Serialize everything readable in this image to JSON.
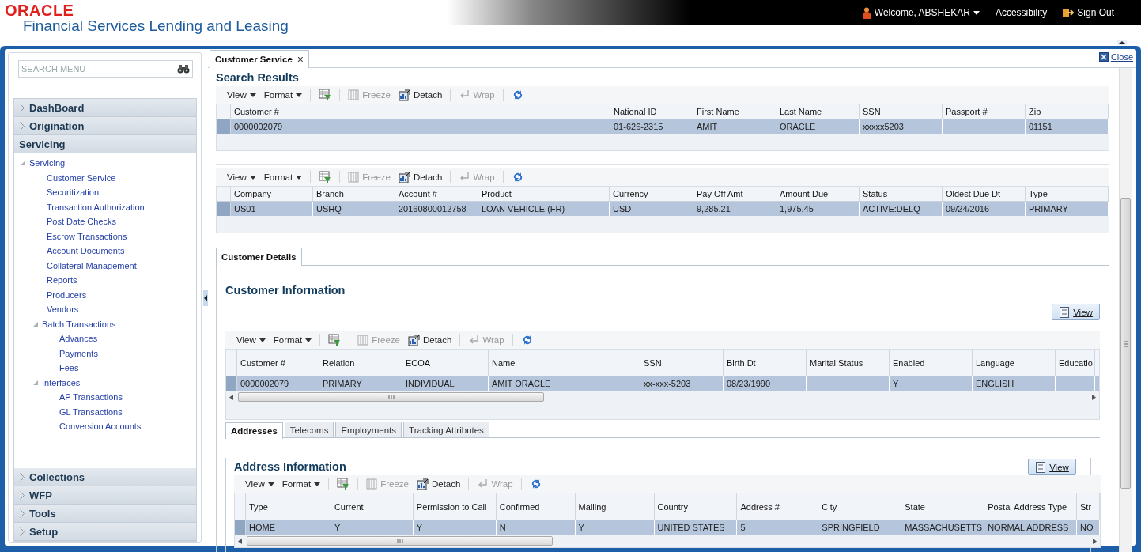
{
  "header": {
    "logo": "ORACLE",
    "app_title": "Financial Services Lending and Leasing",
    "welcome": "Welcome, ABSHEKAR",
    "accessibility": "Accessibility",
    "sign_out": "Sign Out"
  },
  "sidebar": {
    "search": {
      "placeholder": "SEARCH MENU"
    },
    "sections": [
      {
        "label": "DashBoard",
        "expanded": false
      },
      {
        "label": "Origination",
        "expanded": false
      },
      {
        "label": "Servicing",
        "expanded": true,
        "tree": [
          {
            "label": "Servicing",
            "expanded": true,
            "children": [
              {
                "label": "Customer Service"
              },
              {
                "label": "Securitization"
              },
              {
                "label": "Transaction Authorization"
              },
              {
                "label": "Post Date Checks"
              },
              {
                "label": "Escrow Transactions"
              },
              {
                "label": "Account Documents"
              },
              {
                "label": "Collateral Management"
              },
              {
                "label": "Reports"
              },
              {
                "label": "Producers"
              },
              {
                "label": "Vendors"
              },
              {
                "label": "Batch Transactions",
                "expanded": true,
                "children": [
                  {
                    "label": "Advances"
                  },
                  {
                    "label": "Payments"
                  },
                  {
                    "label": "Fees"
                  }
                ]
              },
              {
                "label": "Interfaces",
                "expanded": true,
                "children": [
                  {
                    "label": "AP Transactions"
                  },
                  {
                    "label": "GL Transactions"
                  },
                  {
                    "label": "Conversion Accounts"
                  }
                ]
              }
            ]
          }
        ]
      },
      {
        "label": "Collections",
        "expanded": false
      },
      {
        "label": "WFP",
        "expanded": false
      },
      {
        "label": "Tools",
        "expanded": false
      },
      {
        "label": "Setup",
        "expanded": false
      }
    ]
  },
  "tab": {
    "label": "Customer Service",
    "close": "×"
  },
  "close_link": "Close",
  "search_results": {
    "title": "Search Results",
    "toolbar": [
      {
        "kind": "menu",
        "label": "View",
        "disabled": false
      },
      {
        "kind": "menu",
        "label": "Format",
        "disabled": false
      },
      {
        "kind": "filter",
        "disabled": false
      },
      {
        "kind": "freeze",
        "label": "Freeze",
        "disabled": true
      },
      {
        "kind": "detach",
        "label": "Detach",
        "disabled": false
      },
      {
        "kind": "wrap",
        "label": "Wrap",
        "disabled": true
      },
      {
        "kind": "refresh",
        "disabled": false
      }
    ],
    "table": {
      "columns": [
        "Customer #",
        "National ID",
        "First Name",
        "Last Name",
        "SSN",
        "Passport #",
        "Zip"
      ],
      "rows": [
        {
          "selected": true,
          "cells": [
            "0000002079",
            "01-626-2315",
            "AMIT",
            "ORACLE",
            "xxxxx5203",
            "",
            "01151"
          ]
        }
      ]
    }
  },
  "accounts": {
    "toolbar": [
      {
        "kind": "menu",
        "label": "View",
        "disabled": false
      },
      {
        "kind": "menu",
        "label": "Format",
        "disabled": false
      },
      {
        "kind": "filter",
        "disabled": false
      },
      {
        "kind": "freeze",
        "label": "Freeze",
        "disabled": true
      },
      {
        "kind": "detach",
        "label": "Detach",
        "disabled": false
      },
      {
        "kind": "wrap",
        "label": "Wrap",
        "disabled": true
      },
      {
        "kind": "refresh",
        "disabled": false
      }
    ],
    "table": {
      "columns": [
        "Company",
        "Branch",
        "Account #",
        "Product",
        "Currency",
        "Pay Off Amt",
        "Amount Due",
        "Status",
        "Oldest Due Dt",
        "Type"
      ],
      "rows": [
        {
          "selected": true,
          "cells": [
            "US01",
            "USHQ",
            "20160800012758",
            "LOAN VEHICLE (FR)",
            "USD",
            "9,285.21",
            "1,975.45",
            "ACTIVE:DELQ",
            "09/24/2016",
            "PRIMARY"
          ]
        }
      ]
    }
  },
  "customer_details": {
    "tab": "Customer Details",
    "title": "Customer Information",
    "view_button": "View",
    "toolbar": [
      {
        "kind": "menu",
        "label": "View",
        "disabled": false
      },
      {
        "kind": "menu",
        "label": "Format",
        "disabled": false
      },
      {
        "kind": "filter",
        "disabled": false
      },
      {
        "kind": "freeze",
        "label": "Freeze",
        "disabled": true
      },
      {
        "kind": "detach",
        "label": "Detach",
        "disabled": false
      },
      {
        "kind": "wrap",
        "label": "Wrap",
        "disabled": true
      },
      {
        "kind": "refresh",
        "disabled": false
      }
    ],
    "table": {
      "columns": [
        "Customer #",
        "Relation",
        "ECOA",
        "Name",
        "SSN",
        "Birth Dt",
        "Marital Status",
        "Enabled",
        "Language",
        "Educatio"
      ],
      "rows": [
        {
          "selected": true,
          "cells": [
            "0000002079",
            "PRIMARY",
            "INDIVIDUAL",
            "AMIT ORACLE",
            "xx-xxx-5203",
            "08/23/1990",
            "",
            "Y",
            "ENGLISH",
            ""
          ]
        }
      ]
    },
    "subtabs": [
      {
        "label": "Addresses",
        "selected": true
      },
      {
        "label": "Telecoms",
        "selected": false
      },
      {
        "label": "Employments",
        "selected": false
      },
      {
        "label": "Tracking Attributes",
        "selected": false
      }
    ],
    "address": {
      "title": "Address Information",
      "view_button": "View",
      "toolbar": [
        {
          "kind": "menu",
          "label": "View",
          "disabled": false
        },
        {
          "kind": "menu",
          "label": "Format",
          "disabled": false
        },
        {
          "kind": "filter",
          "disabled": false
        },
        {
          "kind": "freeze",
          "label": "Freeze",
          "disabled": true
        },
        {
          "kind": "detach",
          "label": "Detach",
          "disabled": false
        },
        {
          "kind": "wrap",
          "label": "Wrap",
          "disabled": true
        },
        {
          "kind": "refresh",
          "disabled": false
        }
      ],
      "table": {
        "columns": [
          "Type",
          "Current",
          "Permission to Call",
          "Confirmed",
          "Mailing",
          "Country",
          "Address #",
          "City",
          "State",
          "Postal Address Type",
          "Str"
        ],
        "rows": [
          {
            "selected": true,
            "cells": [
              "HOME",
              "Y",
              "Y",
              "N",
              "Y",
              "UNITED STATES",
              "5",
              "SPRINGFIELD",
              "MASSACHUSETTS",
              "NORMAL ADDRESS",
              "NO"
            ]
          }
        ]
      }
    }
  }
}
